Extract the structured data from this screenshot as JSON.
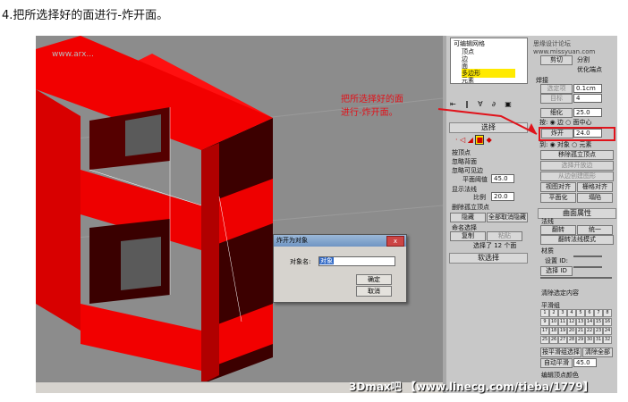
{
  "caption": "4.把所选择好的面进行-炸开面。",
  "annotation": {
    "line1": "把所选择好的面",
    "line2": "进行-炸开面。"
  },
  "viewport_watermark": "www.arx...",
  "footer_watermark": "3Dmax吧 【www.linecg.com/tieba/1779】",
  "top_watermark": "思缘设计论坛 www.missyuan.com",
  "colors": {
    "red": "#f20000",
    "dark_red": "#3c0000",
    "annotation": "#e0131b"
  },
  "stack": {
    "items": [
      "可编辑网格",
      "顶点",
      "边",
      "面",
      "多边形",
      "元素"
    ],
    "selected": "多边形"
  },
  "selection_rollout": {
    "title": "选择",
    "by_vertex": "按顶点",
    "ignore_backfacing": "忽略背面",
    "ignore_visible_edges": "忽略可见边",
    "planar_thresh_label": "平面阈值",
    "planar_thresh_value": "45.0",
    "show_normals": "显示法线",
    "scale_label": "比例",
    "scale_value": "20.0",
    "delete_isolated": "删除孤立顶点",
    "hide": "隐藏",
    "unhide_all": "全部取消隐藏",
    "named_selections": "命名选择",
    "copy": "复制",
    "paste": "粘贴",
    "selected_status": "选择了 12 个面"
  },
  "soft_selection": "软选择",
  "right_panel": {
    "create": "创建",
    "delete": "删除",
    "attach": "附加",
    "detach": "分离",
    "divide": "剪切",
    "split": "分割",
    "refine_ends": "优化端点",
    "weld": "焊接",
    "selected": "选定项",
    "selected_value": "0.1cm",
    "target": "目标",
    "target_value": "4",
    "tessellate": "细化",
    "tessellate_value": "25.0",
    "by": "按:",
    "edge": "边",
    "face_center": "面中心",
    "explode": "炸开",
    "explode_value": "24.0",
    "to": "到:",
    "objects": "对象",
    "elements": "元素",
    "remove_isolated": "移除孤立顶点",
    "select_open_edges": "选择开放边",
    "create_shape": "从边创建图形",
    "view_align": "视图对齐",
    "grid_align": "栅格对齐",
    "planar": "平面化",
    "collapse": "塌陷",
    "surface_props": "曲面属性",
    "normals": "法线",
    "flip": "翻转",
    "unify": "统一",
    "flip_normal_mode": "翻转法线模式",
    "material": "材质",
    "set_id": "设置 ID:",
    "select_id": "选择 ID",
    "clear_selection": "清除选定内容",
    "smoothing_groups": "平滑组",
    "group_numbers": [
      "1",
      "2",
      "3",
      "4",
      "5",
      "6",
      "7",
      "8",
      "9",
      "10",
      "11",
      "12",
      "13",
      "14",
      "15",
      "16",
      "17",
      "18",
      "19",
      "20",
      "21",
      "22",
      "23",
      "24",
      "25",
      "26",
      "27",
      "28",
      "29",
      "30",
      "31",
      "32"
    ],
    "select_by_sg": "按平滑组选择",
    "clear_all": "清除全部",
    "auto_smooth": "自动平滑",
    "auto_smooth_value": "45.0",
    "edit_vertex_colors": "编辑顶点颜色"
  },
  "dialog": {
    "title": "炸开为对象",
    "name_label": "对象名:",
    "name_value": "对象",
    "ok": "确定",
    "cancel": "取消",
    "close": "x"
  }
}
